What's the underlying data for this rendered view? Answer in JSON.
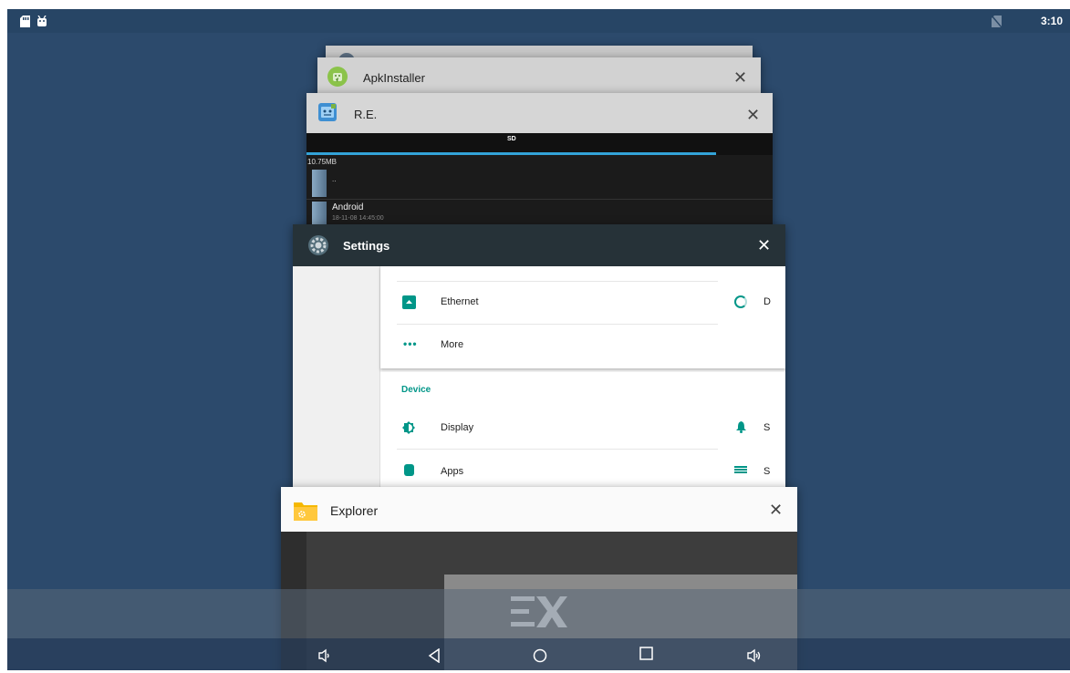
{
  "statusbar": {
    "left_icons": [
      "sd-card-icon",
      "android-icon"
    ],
    "right_icons": [
      "no-sim-icon"
    ],
    "time": "3:10"
  },
  "recents": {
    "cards": [
      {
        "id": "apkinstaller",
        "title": "ApkInstaller",
        "icon": "android-icon"
      },
      {
        "id": "re",
        "title": "R.E.",
        "icon": "root-explorer-icon",
        "content": {
          "tab": "SD",
          "size": "10.75MB",
          "rows": [
            {
              "name": "..",
              "date": ""
            },
            {
              "name": "Android",
              "date": "18-11-08 14:45:00"
            }
          ]
        }
      },
      {
        "id": "settings",
        "title": "Settings",
        "icon": "settings-gear-icon",
        "content": {
          "left_items": [
            {
              "label": "Ethernet",
              "icon": "ethernet-icon"
            },
            {
              "label": "More",
              "icon": "more-dots-icon"
            }
          ],
          "section": "Device",
          "device_items": [
            {
              "label": "Display",
              "icon": "brightness-icon"
            },
            {
              "label": "Apps",
              "icon": "android-apps-icon"
            }
          ],
          "right_partial": [
            {
              "label": "D",
              "icon": "data-usage-icon"
            },
            {
              "label": "S",
              "icon": "bell-icon"
            },
            {
              "label": "S",
              "icon": "storage-icon"
            }
          ]
        }
      },
      {
        "id": "explorer",
        "title": "Explorer",
        "icon": "folder-gear-icon",
        "content": {
          "logo": "EX"
        }
      }
    ],
    "close_glyph": "✕"
  },
  "navbar": {
    "buttons": [
      "volume-down",
      "back",
      "home",
      "recents",
      "volume-up"
    ]
  },
  "colors": {
    "background": "#2c4a6c",
    "settings_header": "#263238",
    "accent": "#009688",
    "explorer_folder": "#f5b800"
  }
}
